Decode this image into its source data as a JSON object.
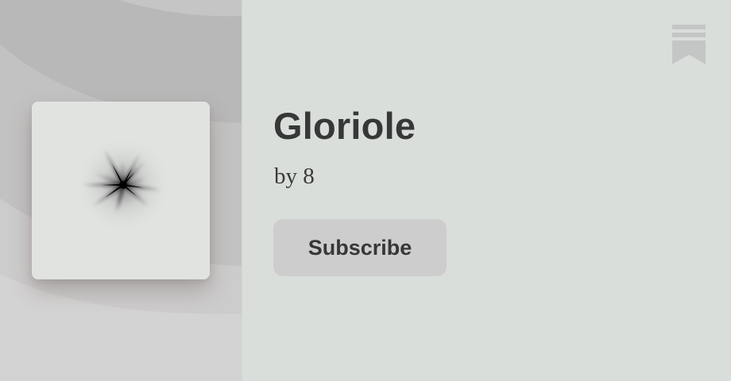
{
  "publication": {
    "title": "Gloriole",
    "byline": "by 8"
  },
  "actions": {
    "subscribe_label": "Subscribe"
  },
  "icons": {
    "brand": "bookmark-icon",
    "cover_art": "starburst"
  },
  "colors": {
    "background": "#dadedb",
    "left_panel": "#b9b8b8",
    "button_bg": "#cdcdcd",
    "text": "#363737",
    "icon": "#c4c6c5"
  }
}
